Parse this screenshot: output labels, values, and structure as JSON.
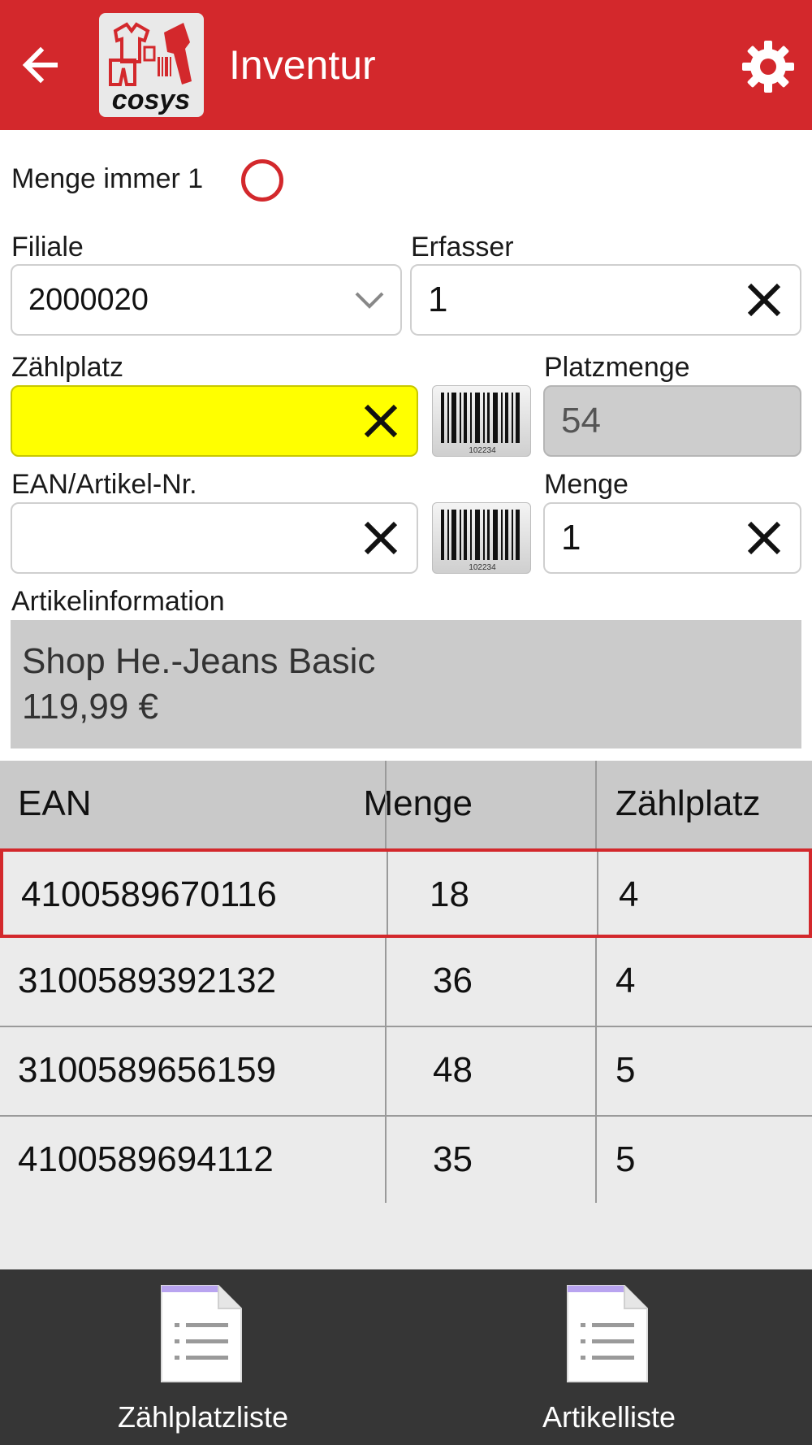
{
  "header": {
    "title": "Inventur",
    "accent_color": "#d3282c",
    "back_icon": "arrow-left-icon",
    "settings_icon": "gear-icon",
    "logo_text": "cosys"
  },
  "form": {
    "menge_immer_1_label": "Menge immer 1",
    "menge_immer_1_checked": false,
    "filiale": {
      "label": "Filiale",
      "value": "2000020"
    },
    "erfasser": {
      "label": "Erfasser",
      "value": "1"
    },
    "zaehlplatz": {
      "label": "Zählplatz",
      "value": "",
      "highlight_color": "#ffff00"
    },
    "platzmenge": {
      "label": "Platzmenge",
      "value": "54"
    },
    "ean": {
      "label": "EAN/Artikel-Nr.",
      "value": ""
    },
    "menge": {
      "label": "Menge",
      "value": "1"
    },
    "barcode_caption": "102234"
  },
  "artikelinfo": {
    "label": "Artikelinformation",
    "name": "Shop He.-Jeans Basic",
    "price": "119,99 €"
  },
  "table": {
    "headers": {
      "ean": "EAN",
      "menge": "Menge",
      "zaehlplatz": "Zählplatz"
    },
    "rows": [
      {
        "ean": "4100589670116",
        "menge": "18",
        "zaehlplatz": "4",
        "selected": true
      },
      {
        "ean": "3100589392132",
        "menge": "36",
        "zaehlplatz": "4",
        "selected": false
      },
      {
        "ean": "3100589656159",
        "menge": "48",
        "zaehlplatz": "5",
        "selected": false
      },
      {
        "ean": "4100589694112",
        "menge": "35",
        "zaehlplatz": "5",
        "selected": false
      }
    ]
  },
  "bottom_nav": [
    {
      "label": "Zählplatzliste",
      "icon": "document-list-icon"
    },
    {
      "label": "Artikelliste",
      "icon": "document-list-icon"
    }
  ]
}
